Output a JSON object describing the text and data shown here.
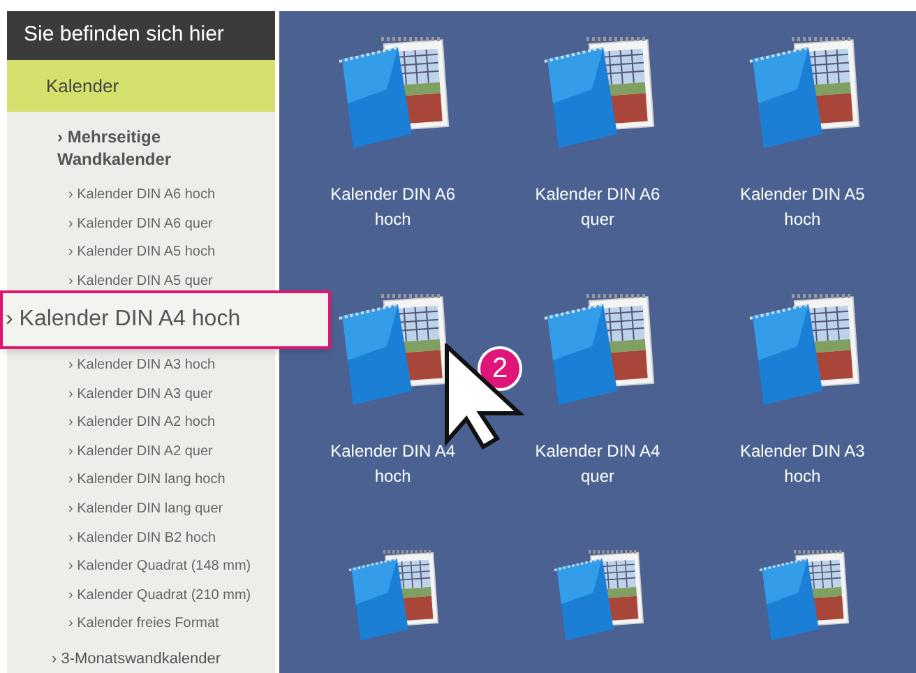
{
  "sidebar": {
    "header": "Sie befinden sich hier",
    "current": "Kalender",
    "group": {
      "marker": "›",
      "label": "Mehrseitige Wandkalender"
    },
    "items_before": [
      {
        "marker": "›",
        "label": "Kalender DIN A6 hoch"
      },
      {
        "marker": "›",
        "label": "Kalender DIN A6 quer"
      },
      {
        "marker": "›",
        "label": "Kalender DIN A5 hoch"
      },
      {
        "marker": "›",
        "label": "Kalender DIN A5 quer"
      }
    ],
    "items_after": [
      {
        "marker": "›",
        "label": "Kalender DIN A3 hoch"
      },
      {
        "marker": "›",
        "label": "Kalender DIN A3 quer"
      },
      {
        "marker": "›",
        "label": "Kalender DIN A2 hoch"
      },
      {
        "marker": "›",
        "label": "Kalender DIN A2 quer"
      },
      {
        "marker": "›",
        "label": "Kalender DIN lang hoch"
      },
      {
        "marker": "›",
        "label": "Kalender DIN lang quer"
      },
      {
        "marker": "›",
        "label": "Kalender DIN B2 hoch"
      },
      {
        "marker": "›",
        "label": "Kalender Quadrat (148 mm)"
      },
      {
        "marker": "›",
        "label": "Kalender Quadrat (210 mm)"
      },
      {
        "marker": "›",
        "label": "Kalender freies Format"
      }
    ],
    "next_group": {
      "marker": "›",
      "label": "3-Monatswandkalender"
    }
  },
  "callout": {
    "marker": "›",
    "label": "Kalender DIN A4 hoch"
  },
  "step_badge": "2",
  "tiles": [
    {
      "kind": "labeled",
      "label": "Kalender DIN A6 hoch"
    },
    {
      "kind": "labeled",
      "label": "Kalender DIN A6 quer"
    },
    {
      "kind": "labeled",
      "label": "Kalender DIN A5 hoch"
    },
    {
      "kind": "labeled",
      "label": "Kalender DIN A4 hoch"
    },
    {
      "kind": "labeled",
      "label": "Kalender DIN A4 quer"
    },
    {
      "kind": "labeled",
      "label": "Kalender DIN A3 hoch"
    },
    {
      "kind": "cut_off"
    },
    {
      "kind": "cut_off"
    },
    {
      "kind": "cut_off"
    }
  ]
}
